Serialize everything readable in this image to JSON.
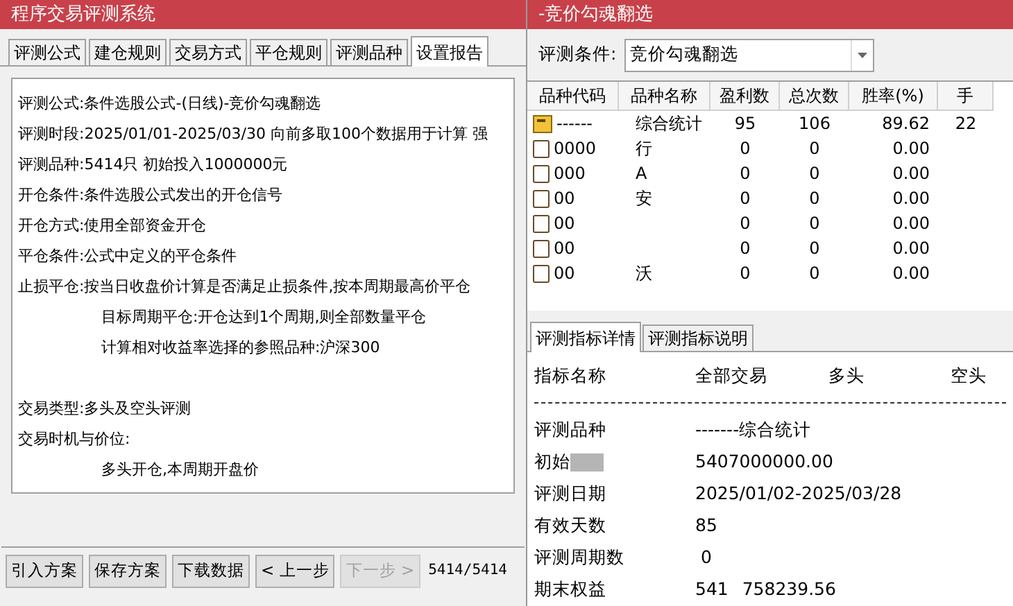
{
  "left_window": {
    "title": "程序交易评测系统",
    "tabs": [
      {
        "label": "评测公式",
        "selected": false
      },
      {
        "label": "建仓规则",
        "selected": false
      },
      {
        "label": "交易方式",
        "selected": false
      },
      {
        "label": "平仓规则",
        "selected": false
      },
      {
        "label": "评测品种",
        "selected": false
      },
      {
        "label": "设置报告",
        "selected": true
      }
    ],
    "report_lines": [
      {
        "kind": "field",
        "label": "评测公式:",
        "value": "条件选股公式-(日线)-竞价勾魂翻选"
      },
      {
        "kind": "field",
        "label": "评测时段:",
        "value": "2025/01/01-2025/03/30 向前多取100个数据用于计算 强"
      },
      {
        "kind": "field",
        "label": "评测品种:",
        "value": "5414只 初始投入1000000元"
      },
      {
        "kind": "field",
        "label": "开仓条件:",
        "value": "条件选股公式发出的开仓信号"
      },
      {
        "kind": "field",
        "label": "开仓方式:",
        "value": "使用全部资金开仓"
      },
      {
        "kind": "field",
        "label": "平仓条件:",
        "value": "公式中定义的平仓条件"
      },
      {
        "kind": "field",
        "label": "止损平仓:",
        "value": "按当日收盘价计算是否满足止损条件,按本周期最高价平仓"
      },
      {
        "kind": "indent",
        "value": "目标周期平仓:开仓达到1个周期,则全部数量平仓"
      },
      {
        "kind": "indent",
        "value": "计算相对收益率选择的参照品种:沪深300"
      },
      {
        "kind": "blank"
      },
      {
        "kind": "field",
        "label": "交易类型:",
        "value": "多头及空头评测"
      },
      {
        "kind": "field",
        "label": "交易时机与价位:"
      },
      {
        "kind": "indent",
        "value": "多头开仓,本周期开盘价"
      }
    ],
    "buttons": [
      {
        "label": "引入方案",
        "disabled": false
      },
      {
        "label": "保存方案",
        "disabled": false
      },
      {
        "label": "下载数据",
        "disabled": false
      },
      {
        "label": "< 上一步",
        "disabled": false
      },
      {
        "label": "下一步 >",
        "disabled": true
      }
    ],
    "progress": "5414/5414"
  },
  "right_window": {
    "title": "-竞价勾魂翻选",
    "condition": {
      "label": "评测条件:",
      "value": "竞价勾魂翻选"
    },
    "table": {
      "columns": [
        "品种代码",
        "品种名称",
        "盈利数",
        "总次数",
        "胜率(%)",
        "手"
      ],
      "rows": [
        {
          "kind": "summary",
          "cells": [
            "------",
            "综合统计",
            "95",
            "106",
            "89.62",
            "22"
          ]
        },
        {
          "kind": "item",
          "cells": [
            "0000",
            "行",
            "0",
            "0",
            "0.00"
          ]
        },
        {
          "kind": "item",
          "cells": [
            "000",
            "A",
            "0",
            "0",
            "0.00"
          ]
        },
        {
          "kind": "item",
          "cells": [
            "00",
            "安",
            "0",
            "0",
            "0.00"
          ]
        },
        {
          "kind": "item",
          "cells": [
            "00",
            "",
            "0",
            "0",
            "0.00"
          ]
        },
        {
          "kind": "item",
          "cells": [
            "00",
            "",
            "0",
            "0",
            "0.00"
          ]
        },
        {
          "kind": "item",
          "cells": [
            "00",
            "沃",
            "0",
            "0",
            "0.00"
          ]
        }
      ]
    },
    "tabs": [
      {
        "label": "评测指标详情",
        "selected": true
      },
      {
        "label": "评测指标说明",
        "selected": false
      }
    ],
    "detail": {
      "columns": [
        "指标名称",
        "全部交易",
        "多头",
        "空头"
      ],
      "rows": [
        {
          "name": "评测品种",
          "value": "-------综合统计"
        },
        {
          "name": "初始",
          "blurred": true,
          "value": "5407000000.00"
        },
        {
          "name": "评测日期",
          "value": "2025/01/02-2025/03/28"
        },
        {
          "name": "有效天数",
          "value": "85"
        },
        {
          "name": "评测周期数",
          "value": " 0"
        },
        {
          "name": "期末权益",
          "value": "541",
          "value_tail": "758239.56"
        }
      ]
    }
  }
}
